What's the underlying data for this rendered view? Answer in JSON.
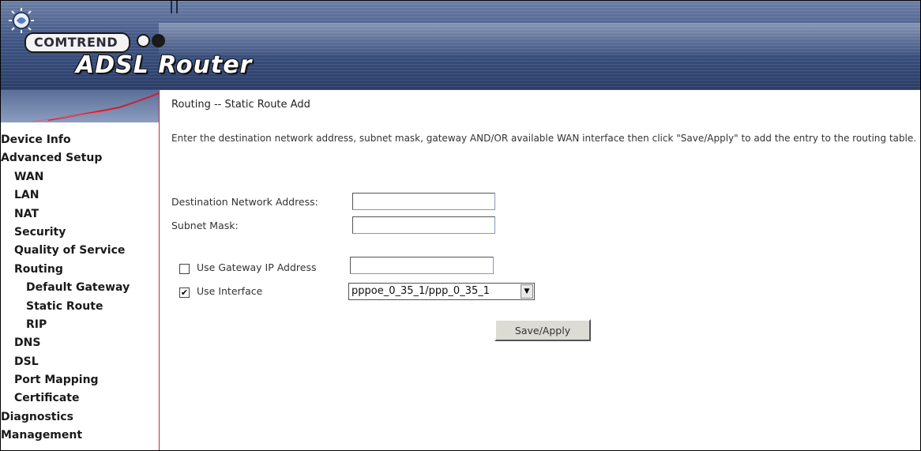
{
  "header": {
    "brand": "COMTREND",
    "product": "ADSL Router"
  },
  "sidebar": {
    "items": [
      {
        "label": "Device Info",
        "level": 0
      },
      {
        "label": "Advanced Setup",
        "level": 0
      },
      {
        "label": "WAN",
        "level": 1
      },
      {
        "label": "LAN",
        "level": 1
      },
      {
        "label": "NAT",
        "level": 1
      },
      {
        "label": "Security",
        "level": 1
      },
      {
        "label": "Quality of Service",
        "level": 1
      },
      {
        "label": "Routing",
        "level": 1
      },
      {
        "label": "Default Gateway",
        "level": 2
      },
      {
        "label": "Static Route",
        "level": 2
      },
      {
        "label": "RIP",
        "level": 2
      },
      {
        "label": "DNS",
        "level": 1
      },
      {
        "label": "DSL",
        "level": 1
      },
      {
        "label": "Port Mapping",
        "level": 1
      },
      {
        "label": "Certificate",
        "level": 1
      },
      {
        "label": "Diagnostics",
        "level": 0
      },
      {
        "label": "Management",
        "level": 0
      }
    ]
  },
  "main": {
    "title": "Routing -- Static Route Add",
    "description": "Enter the destination network address, subnet mask, gateway AND/OR available WAN interface then click \"Save/Apply\" to add the entry to the routing table.",
    "form": {
      "dest_label": "Destination Network Address:",
      "dest_value": "",
      "mask_label": "Subnet Mask:",
      "mask_value": "",
      "gateway_label": "Use Gateway IP Address",
      "gateway_checked": false,
      "gateway_value": "",
      "interface_label": "Use Interface",
      "interface_checked": true,
      "interface_value": "pppoe_0_35_1/ppp_0_35_1",
      "check_mark": "✔",
      "submit_label": "Save/Apply"
    }
  }
}
